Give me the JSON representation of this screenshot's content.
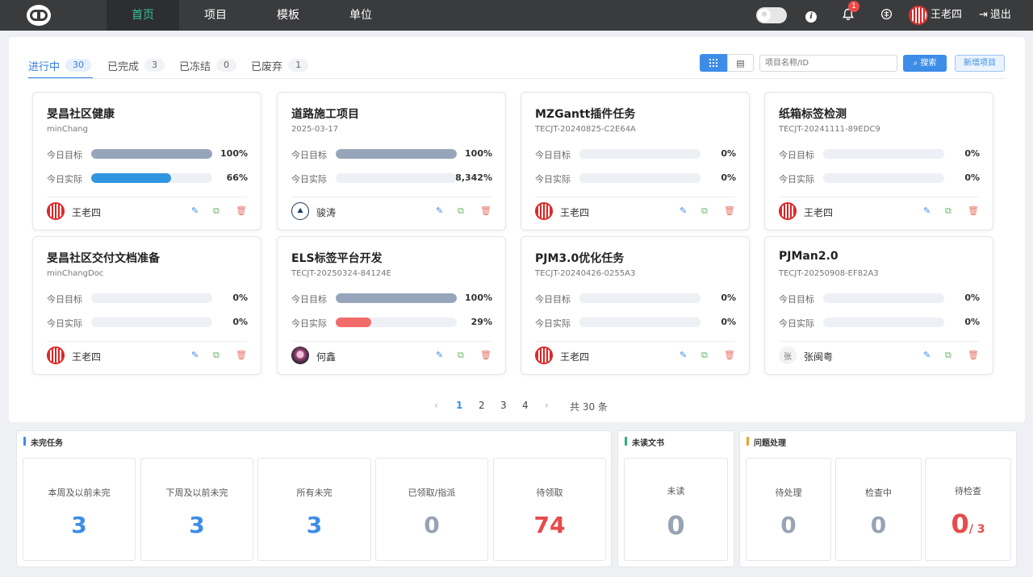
{
  "topbar": {
    "nav": [
      "首页",
      "项目",
      "模板",
      "单位"
    ],
    "active_nav": "首页",
    "notification_count": "1",
    "user_name": "王老四",
    "logout_label": "退出"
  },
  "tabs": [
    {
      "label": "进行中",
      "count": "30",
      "active": true
    },
    {
      "label": "已完成",
      "count": "3",
      "active": false
    },
    {
      "label": "已冻结",
      "count": "0",
      "active": false
    },
    {
      "label": "已废弃",
      "count": "1",
      "active": false
    }
  ],
  "toolbar": {
    "search_placeholder": "项目名称/ID",
    "search_label": "搜索",
    "new_label": "新增项目"
  },
  "card_labels": {
    "target": "今日目标",
    "actual": "今日实际"
  },
  "cards": [
    {
      "title": "旻昌社区健康",
      "sub": "minChang",
      "target": 100,
      "target_text": "100%",
      "actual": 66,
      "actual_text": "66%",
      "actual_color": "#3295e0",
      "owner": "王老四",
      "avatar": "seal"
    },
    {
      "title": "道路施工项目",
      "sub": "2025-03-17",
      "target": 100,
      "target_text": "100%",
      "actual": 0,
      "actual_text": "8,342%",
      "actual_color": "#3295e0",
      "owner": "骏涛",
      "avatar": "line"
    },
    {
      "title": "MZGantt插件任务",
      "sub": "TECJT-20240825-C2E64A",
      "target": 0,
      "target_text": "0%",
      "actual": 0,
      "actual_text": "0%",
      "actual_color": "#3295e0",
      "owner": "王老四",
      "avatar": "seal"
    },
    {
      "title": "纸箱标签检测",
      "sub": "TECJT-20241111-89EDC9",
      "target": 0,
      "target_text": "0%",
      "actual": 0,
      "actual_text": "0%",
      "actual_color": "#3295e0",
      "owner": "王老四",
      "avatar": "seal"
    },
    {
      "title": "旻昌社区交付文档准备",
      "sub": "minChangDoc",
      "target": 0,
      "target_text": "0%",
      "actual": 0,
      "actual_text": "0%",
      "actual_color": "#3295e0",
      "owner": "王老四",
      "avatar": "seal"
    },
    {
      "title": "ELS标签平台开发",
      "sub": "TECJT-20250324-84124E",
      "target": 100,
      "target_text": "100%",
      "actual": 29,
      "actual_text": "29%",
      "actual_color": "#f26b6b",
      "owner": "何鑫",
      "avatar": "photo"
    },
    {
      "title": "PJM3.0优化任务",
      "sub": "TECJT-20240426-0255A3",
      "target": 0,
      "target_text": "0%",
      "actual": 0,
      "actual_text": "0%",
      "actual_color": "#3295e0",
      "owner": "王老四",
      "avatar": "seal"
    },
    {
      "title": "PJMan2.0",
      "sub": "TECJT-20250908-EF82A3",
      "target": 0,
      "target_text": "0%",
      "actual": 0,
      "actual_text": "0%",
      "actual_color": "#3295e0",
      "owner": "张闽粤",
      "avatar": "text",
      "avatar_text": "张"
    }
  ],
  "target_bar_color": "#97a5bb",
  "pagination": {
    "pages": [
      "1",
      "2",
      "3",
      "4"
    ],
    "current": "1",
    "total": "共 30 条"
  },
  "panels": {
    "tasks": {
      "title": "未完任务",
      "stats": [
        {
          "label": "本周及以前未完",
          "value": "3"
        },
        {
          "label": "下周及以前未完",
          "value": "3"
        },
        {
          "label": "所有未完",
          "value": "3"
        },
        {
          "label": "已领取/指派",
          "value": "0"
        },
        {
          "label": "待领取",
          "value": "74"
        }
      ]
    },
    "docs": {
      "title": "未读文书",
      "stats": [
        {
          "label": "未读",
          "value": "0"
        }
      ]
    },
    "issues": {
      "title": "问题处理",
      "stats": [
        {
          "label": "待处理",
          "value": "0"
        },
        {
          "label": "检查中",
          "value": "0"
        },
        {
          "label": "待检查",
          "value": "0",
          "suffix": "/ 3"
        }
      ]
    }
  }
}
